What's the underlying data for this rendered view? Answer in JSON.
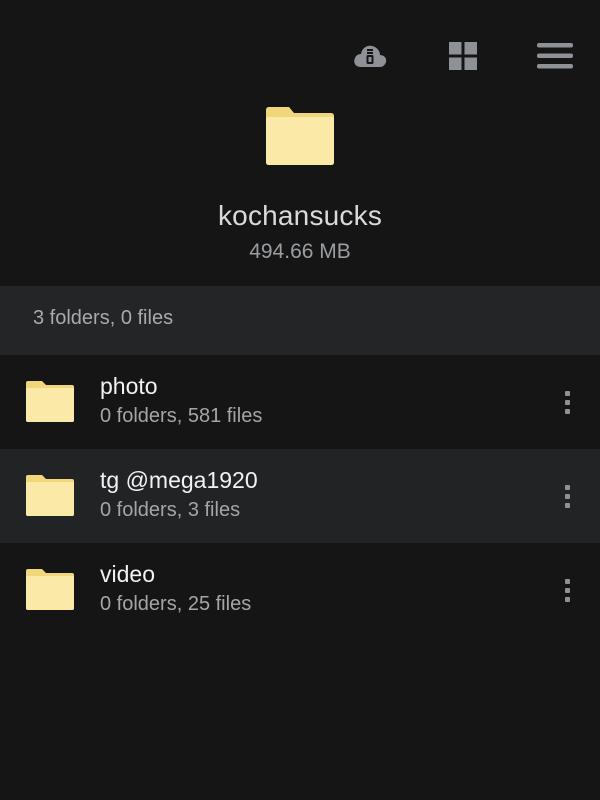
{
  "toolbar": {
    "buttons": [
      {
        "icon": "cloud-download-icon"
      },
      {
        "icon": "grid-view-icon"
      },
      {
        "icon": "menu-icon"
      }
    ]
  },
  "folder": {
    "icon": "folder-icon",
    "name": "kochansucks",
    "size": "494.66 MB"
  },
  "summary": "3 folders, 0 files",
  "items": [
    {
      "name": "photo",
      "meta": "0 folders, 581 files"
    },
    {
      "name": "tg @mega1920",
      "meta": "0 folders, 3 files"
    },
    {
      "name": "video",
      "meta": "0 folders, 25 files"
    }
  ],
  "colors": {
    "background": "#151515",
    "band": "#232526",
    "folder_fill": "#fbe9a8",
    "folder_tab": "#f2d67c",
    "icon_gray": "#8e9195"
  }
}
